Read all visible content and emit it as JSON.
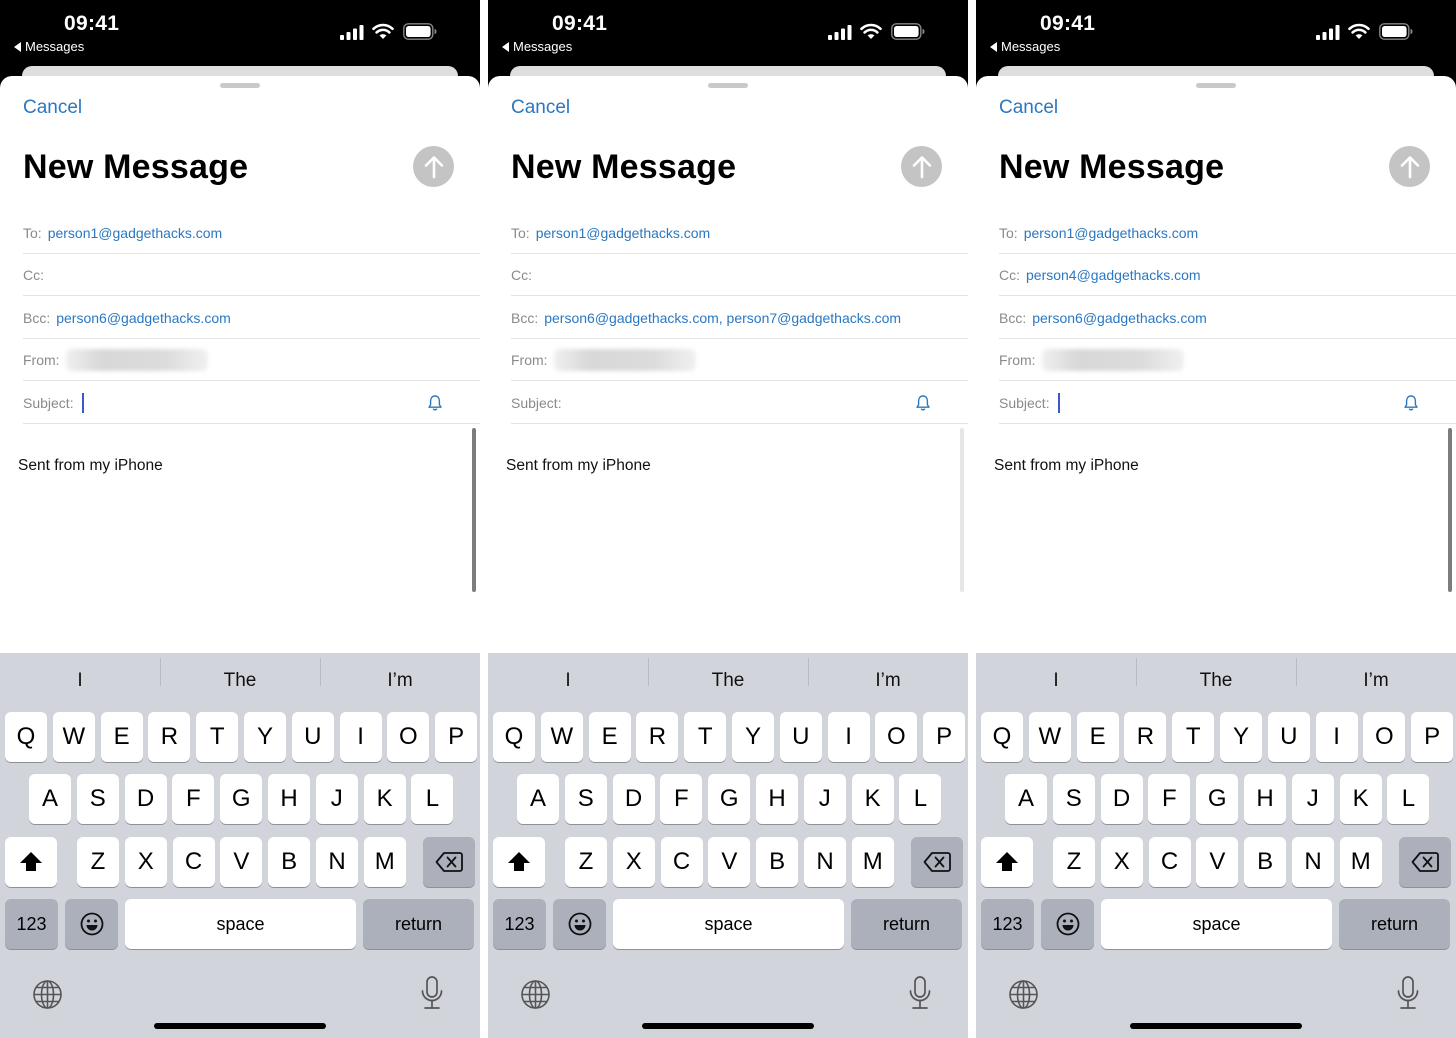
{
  "panels": [
    {
      "status_bar": {
        "time": "09:41",
        "back_app": "Messages"
      },
      "nav": {
        "cancel_label": "Cancel"
      },
      "title": "New Message",
      "fields": {
        "to_label": "To:",
        "to_value": "person1@gadgethacks.com",
        "cc_label": "Cc:",
        "cc_value": "",
        "bcc_label": "Bcc:",
        "bcc_value": "person6@gadgethacks.com",
        "from_label": "From:",
        "subject_label": "Subject:",
        "subject_value": ""
      },
      "subject_focused": true,
      "body": "Sent from my iPhone",
      "scrollbar_visible": true
    },
    {
      "status_bar": {
        "time": "09:41",
        "back_app": "Messages"
      },
      "nav": {
        "cancel_label": "Cancel"
      },
      "title": "New Message",
      "fields": {
        "to_label": "To:",
        "to_value": "person1@gadgethacks.com",
        "cc_label": "Cc:",
        "cc_value": "",
        "bcc_label": "Bcc:",
        "bcc_value": "person6@gadgethacks.com, person7@gadgethacks.com",
        "from_label": "From:",
        "subject_label": "Subject:",
        "subject_value": ""
      },
      "subject_focused": false,
      "body": "Sent from my iPhone",
      "scrollbar_visible": false
    },
    {
      "status_bar": {
        "time": "09:41",
        "back_app": "Messages"
      },
      "nav": {
        "cancel_label": "Cancel"
      },
      "title": "New Message",
      "fields": {
        "to_label": "To:",
        "to_value": "person1@gadgethacks.com",
        "cc_label": "Cc:",
        "cc_value": "person4@gadgethacks.com",
        "bcc_label": "Bcc:",
        "bcc_value": "person6@gadgethacks.com",
        "from_label": "From:",
        "subject_label": "Subject:",
        "subject_value": ""
      },
      "subject_focused": true,
      "body": "Sent from my iPhone",
      "scrollbar_visible": true
    }
  ],
  "keyboard": {
    "suggestions": [
      "I",
      "The",
      "I’m"
    ],
    "row1": [
      "Q",
      "W",
      "E",
      "R",
      "T",
      "Y",
      "U",
      "I",
      "O",
      "P"
    ],
    "row2": [
      "A",
      "S",
      "D",
      "F",
      "G",
      "H",
      "J",
      "K",
      "L"
    ],
    "row3": [
      "Z",
      "X",
      "C",
      "V",
      "B",
      "N",
      "M"
    ],
    "numbers_label": "123",
    "space_label": "space",
    "return_label": "return"
  },
  "colors": {
    "accent": "#2a78c2",
    "send_disabled": "#c4c4c4",
    "keyboard_bg": "#d1d4db",
    "caret": "#3a57d0"
  }
}
